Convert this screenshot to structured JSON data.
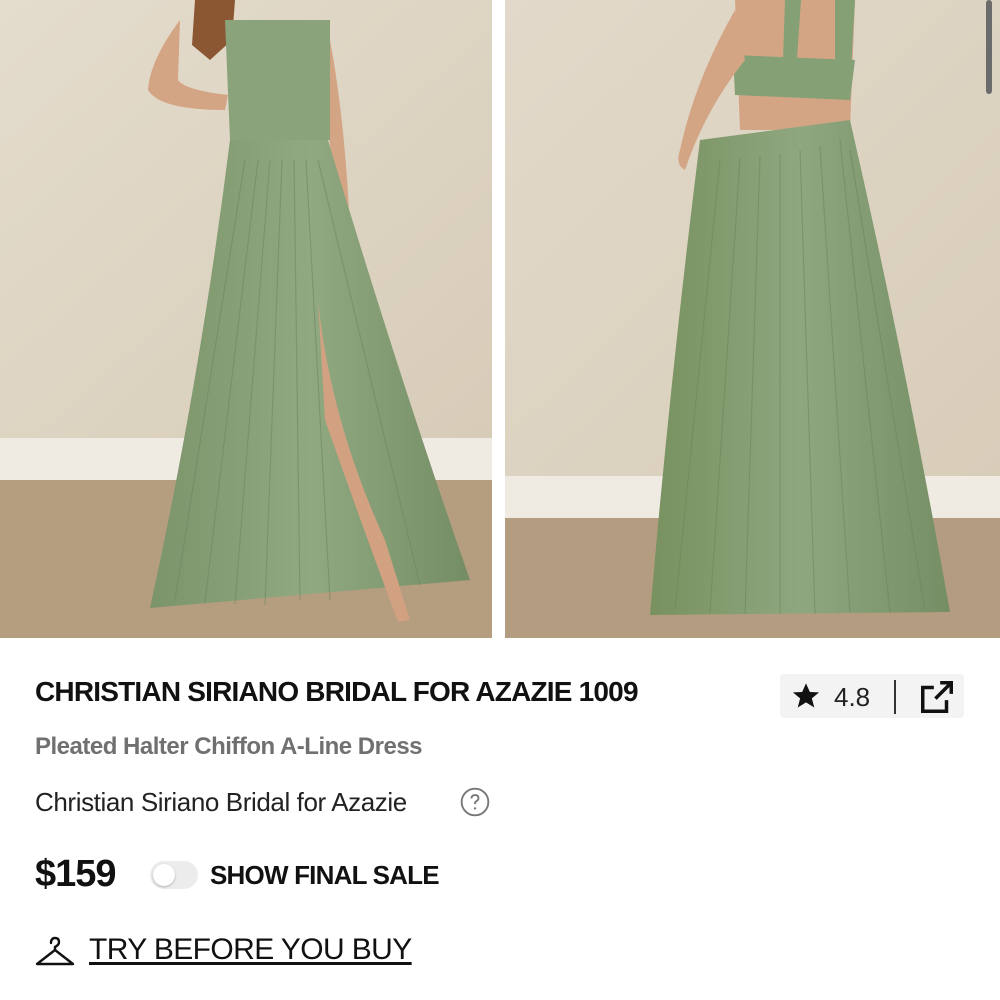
{
  "product": {
    "title": "CHRISTIAN SIRIANO BRIDAL FOR AZAZIE 1009",
    "subtitle": "Pleated Halter Chiffon A-Line Dress",
    "designer": "Christian Siriano Bridal for Azazie",
    "price": "$159",
    "rating": "4.8"
  },
  "final_sale": {
    "label": "SHOW FINAL SALE",
    "enabled": false
  },
  "try_before_you_buy": {
    "label": "TRY BEFORE YOU BUY"
  },
  "icons": {
    "rating": "star-icon",
    "share": "share-external-icon",
    "help": "question-circle-icon",
    "try": "hanger-icon"
  },
  "colors": {
    "dress": "#87a077",
    "wall": "#ddd3c2",
    "floor": "#b49c80",
    "muted_text": "#707070"
  }
}
